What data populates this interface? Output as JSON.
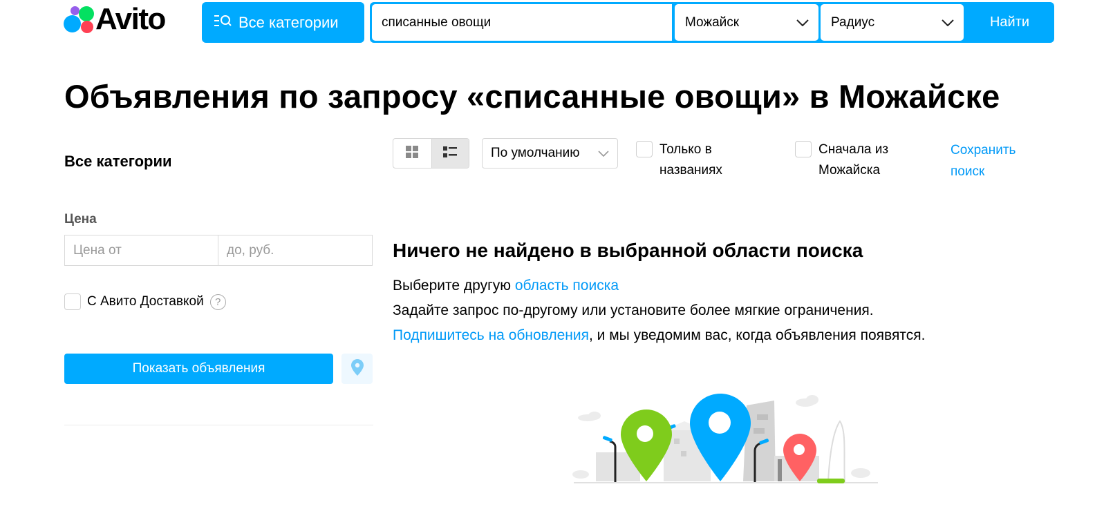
{
  "header": {
    "logo_text": "Avito",
    "categories_button": "Все категории",
    "search_value": "списанные овощи",
    "city": "Можайск",
    "radius": "Радиус",
    "find_button": "Найти"
  },
  "page_title": "Объявления по запросу «списанные овощи» в Можайске",
  "sidebar": {
    "category": "Все категории",
    "price_label": "Цена",
    "price_from_placeholder": "Цена от",
    "price_to_placeholder": "до, руб.",
    "delivery_label": "С Авито Доставкой",
    "help_icon": "?",
    "show_button": "Показать объявления"
  },
  "toolbar": {
    "sort": "По умолчанию",
    "only_titles_line1": "Только в",
    "only_titles_line2": "названиях",
    "first_from_line1": "Сначала из",
    "first_from_line2": "Можайска",
    "save_search_line1": "Сохранить",
    "save_search_line2": "поиск"
  },
  "empty_state": {
    "title": "Ничего не найдено в выбранной области поиска",
    "line1_text": "Выберите другую ",
    "line1_link": "область поиска",
    "line2_text": "Задайте запрос по-другому или установите более мягкие ограничения.",
    "line3_link": "Подпишитесь на обновления",
    "line3_text": ", и мы уведомим вас, когда объявления появятся."
  },
  "colors": {
    "accent": "#00aaff",
    "link": "#0099f7",
    "pin_green": "#7fcc1c",
    "pin_blue": "#00aaff",
    "pin_red": "#ff6163"
  }
}
